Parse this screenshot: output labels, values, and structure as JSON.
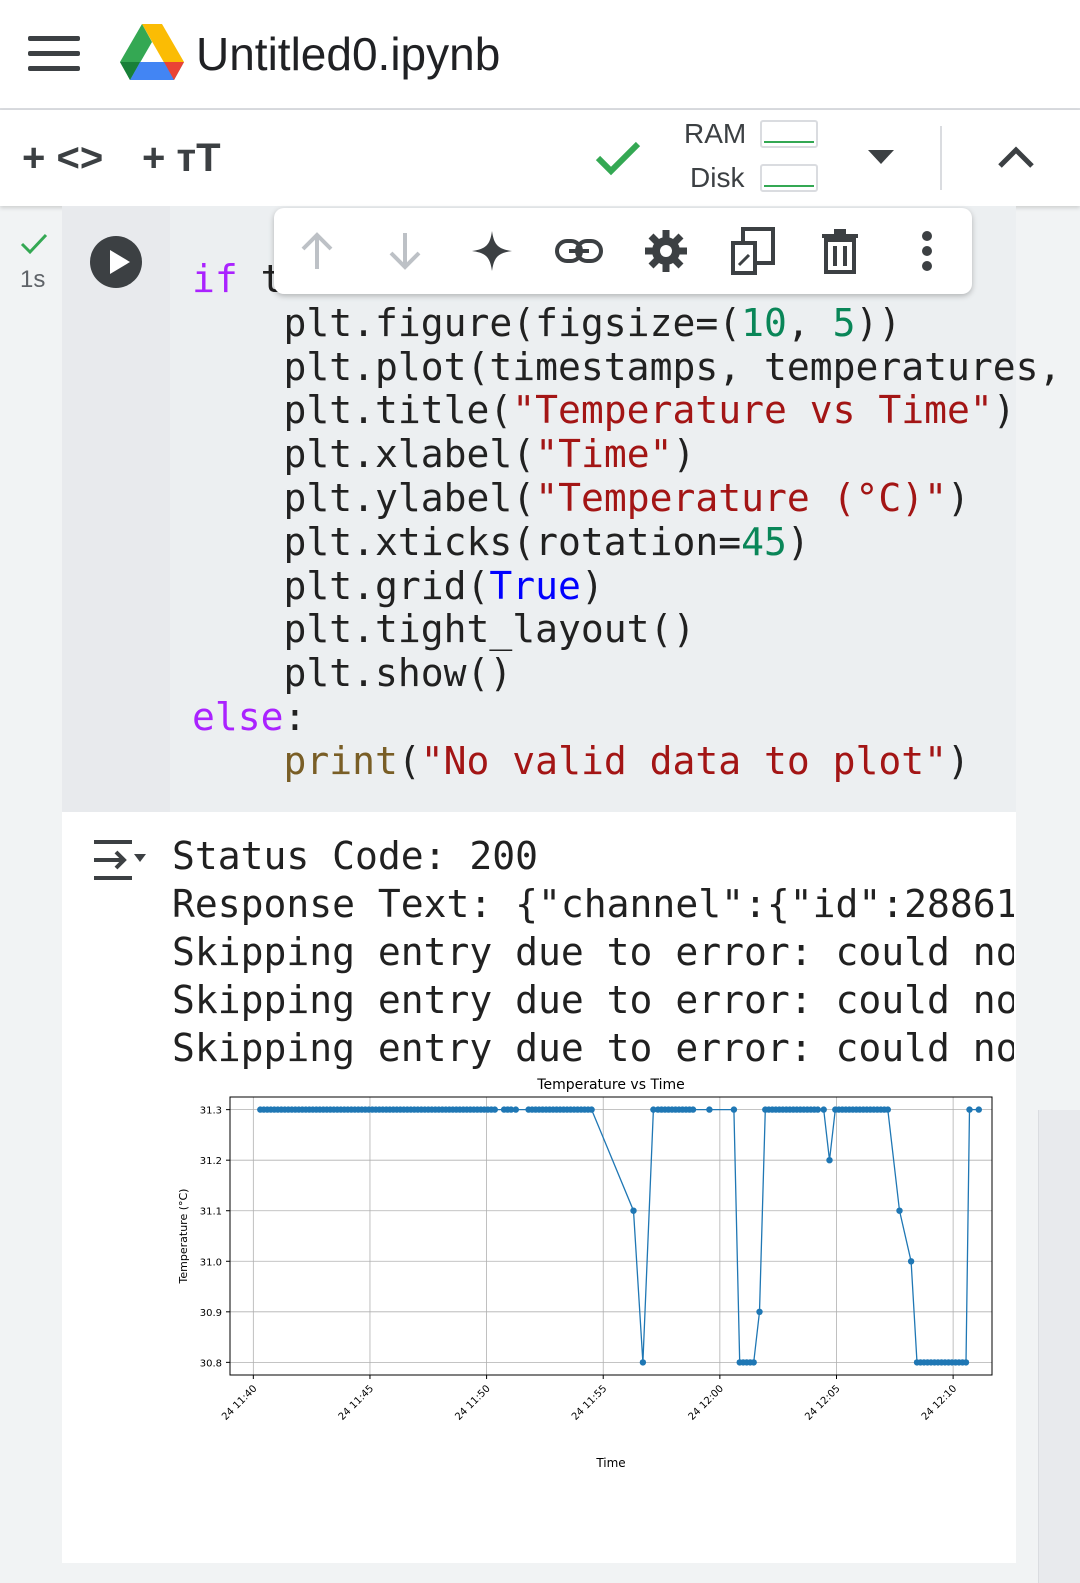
{
  "header": {
    "title": "Untitled0.ipynb"
  },
  "toolbar": {
    "add_code_label": "+ <>",
    "add_text_label": "+ тT",
    "ram_label": "RAM",
    "disk_label": "Disk"
  },
  "cell": {
    "exec_time": "1s",
    "code_lines": [
      {
        "indent": "",
        "parts": [
          {
            "t": "if",
            "c": "kw"
          },
          {
            "t": " t",
            "c": ""
          }
        ]
      },
      {
        "indent": "    ",
        "parts": [
          {
            "t": "plt.figure(figsize=(",
            "c": ""
          },
          {
            "t": "10",
            "c": "num"
          },
          {
            "t": ", ",
            "c": ""
          },
          {
            "t": "5",
            "c": "num"
          },
          {
            "t": "))",
            "c": ""
          }
        ]
      },
      {
        "indent": "    ",
        "parts": [
          {
            "t": "plt.plot(timestamps, temperatures,",
            "c": ""
          }
        ]
      },
      {
        "indent": "    ",
        "parts": [
          {
            "t": "plt.title(",
            "c": ""
          },
          {
            "t": "\"Temperature vs Time\"",
            "c": "str"
          },
          {
            "t": ")",
            "c": ""
          }
        ]
      },
      {
        "indent": "    ",
        "parts": [
          {
            "t": "plt.xlabel(",
            "c": ""
          },
          {
            "t": "\"Time\"",
            "c": "str"
          },
          {
            "t": ")",
            "c": ""
          }
        ]
      },
      {
        "indent": "    ",
        "parts": [
          {
            "t": "plt.ylabel(",
            "c": ""
          },
          {
            "t": "\"Temperature (°C)\"",
            "c": "str"
          },
          {
            "t": ")",
            "c": ""
          }
        ]
      },
      {
        "indent": "    ",
        "parts": [
          {
            "t": "plt.xticks(rotation=",
            "c": ""
          },
          {
            "t": "45",
            "c": "num"
          },
          {
            "t": ")",
            "c": ""
          }
        ]
      },
      {
        "indent": "    ",
        "parts": [
          {
            "t": "plt.grid(",
            "c": ""
          },
          {
            "t": "True",
            "c": "bool"
          },
          {
            "t": ")",
            "c": ""
          }
        ]
      },
      {
        "indent": "    ",
        "parts": [
          {
            "t": "plt.tight_layout()",
            "c": ""
          }
        ]
      },
      {
        "indent": "    ",
        "parts": [
          {
            "t": "plt.show()",
            "c": ""
          }
        ]
      },
      {
        "indent": "",
        "parts": [
          {
            "t": "else",
            "c": "kw"
          },
          {
            "t": ":",
            "c": ""
          }
        ]
      },
      {
        "indent": "    ",
        "parts": [
          {
            "t": "print",
            "c": "fn"
          },
          {
            "t": "(",
            "c": ""
          },
          {
            "t": "\"No valid data to plot\"",
            "c": "str"
          },
          {
            "t": ")",
            "c": ""
          }
        ]
      }
    ]
  },
  "output": {
    "lines": [
      "Status Code: 200",
      "Response Text: {\"channel\":{\"id\":28861",
      "Skipping entry due to error: could no",
      "Skipping entry due to error: could no",
      "Skipping entry due to error: could no"
    ]
  },
  "icons": {
    "menu": "hamburger-icon",
    "logo": "google-drive-icon",
    "saved": "check-icon",
    "dropdown": "chevron-down-icon",
    "collapse": "chevron-up-icon",
    "cell_tools": [
      "arrow-up-icon",
      "arrow-down-icon",
      "sparkle-icon",
      "link-icon",
      "gear-icon",
      "mirror-cell-icon",
      "trash-icon",
      "more-vert-icon"
    ]
  },
  "colors": {
    "series": "#1f77b4",
    "check": "#34a853",
    "keyword": "#aa22ff",
    "string": "#a31515"
  },
  "chart_data": {
    "type": "line",
    "title": "Temperature vs Time",
    "xlabel": "Time",
    "ylabel": "Temperature (°C)",
    "x_ticks": [
      "24 11:40",
      "24 11:45",
      "24 11:50",
      "24 11:55",
      "24 12:00",
      "24 12:05",
      "24 12:10"
    ],
    "y_ticks": [
      "30.8",
      "30.9",
      "31.0",
      "31.1",
      "31.2",
      "31.3"
    ],
    "ylim": [
      30.8,
      31.3
    ],
    "grid": true,
    "x_unit": "time (HH:MM:SS on the 24th)",
    "series": [
      {
        "marker": "circle",
        "points": [
          [
            "11:40:18",
            31.3
          ],
          [
            "11:40:27",
            31.3
          ],
          [
            "11:40:36",
            31.3
          ],
          [
            "11:40:45",
            31.3
          ],
          [
            "11:40:54",
            31.3
          ],
          [
            "11:41:03",
            31.3
          ],
          [
            "11:41:12",
            31.3
          ],
          [
            "11:41:21",
            31.3
          ],
          [
            "11:41:30",
            31.3
          ],
          [
            "11:41:39",
            31.3
          ],
          [
            "11:41:48",
            31.3
          ],
          [
            "11:41:57",
            31.3
          ],
          [
            "11:42:06",
            31.3
          ],
          [
            "11:42:15",
            31.3
          ],
          [
            "11:42:24",
            31.3
          ],
          [
            "11:42:33",
            31.3
          ],
          [
            "11:42:42",
            31.3
          ],
          [
            "11:42:51",
            31.3
          ],
          [
            "11:43:00",
            31.3
          ],
          [
            "11:43:09",
            31.3
          ],
          [
            "11:43:18",
            31.3
          ],
          [
            "11:43:27",
            31.3
          ],
          [
            "11:43:36",
            31.3
          ],
          [
            "11:43:45",
            31.3
          ],
          [
            "11:43:54",
            31.3
          ],
          [
            "11:44:03",
            31.3
          ],
          [
            "11:44:12",
            31.3
          ],
          [
            "11:44:21",
            31.3
          ],
          [
            "11:44:30",
            31.3
          ],
          [
            "11:44:39",
            31.3
          ],
          [
            "11:44:48",
            31.3
          ],
          [
            "11:44:57",
            31.3
          ],
          [
            "11:45:06",
            31.3
          ],
          [
            "11:45:15",
            31.3
          ],
          [
            "11:45:24",
            31.3
          ],
          [
            "11:45:33",
            31.3
          ],
          [
            "11:45:42",
            31.3
          ],
          [
            "11:45:51",
            31.3
          ],
          [
            "11:46:00",
            31.3
          ],
          [
            "11:46:09",
            31.3
          ],
          [
            "11:46:18",
            31.3
          ],
          [
            "11:46:27",
            31.3
          ],
          [
            "11:46:36",
            31.3
          ],
          [
            "11:46:45",
            31.3
          ],
          [
            "11:46:54",
            31.3
          ],
          [
            "11:47:03",
            31.3
          ],
          [
            "11:47:12",
            31.3
          ],
          [
            "11:47:21",
            31.3
          ],
          [
            "11:47:30",
            31.3
          ],
          [
            "11:47:39",
            31.3
          ],
          [
            "11:47:48",
            31.3
          ],
          [
            "11:47:57",
            31.3
          ],
          [
            "11:48:06",
            31.3
          ],
          [
            "11:48:15",
            31.3
          ],
          [
            "11:48:24",
            31.3
          ],
          [
            "11:48:33",
            31.3
          ],
          [
            "11:48:42",
            31.3
          ],
          [
            "11:48:51",
            31.3
          ],
          [
            "11:49:00",
            31.3
          ],
          [
            "11:49:09",
            31.3
          ],
          [
            "11:49:18",
            31.3
          ],
          [
            "11:49:27",
            31.3
          ],
          [
            "11:49:36",
            31.3
          ],
          [
            "11:49:45",
            31.3
          ],
          [
            "11:49:54",
            31.3
          ],
          [
            "11:50:03",
            31.3
          ],
          [
            "11:50:12",
            31.3
          ],
          [
            "11:50:21",
            31.3
          ],
          [
            "11:50:45",
            31.3
          ],
          [
            "11:50:54",
            31.3
          ],
          [
            "11:51:03",
            31.3
          ],
          [
            "11:51:15",
            31.3
          ],
          [
            "11:51:48",
            31.3
          ],
          [
            "11:51:57",
            31.3
          ],
          [
            "11:52:06",
            31.3
          ],
          [
            "11:52:15",
            31.3
          ],
          [
            "11:52:24",
            31.3
          ],
          [
            "11:52:33",
            31.3
          ],
          [
            "11:52:42",
            31.3
          ],
          [
            "11:52:51",
            31.3
          ],
          [
            "11:53:00",
            31.3
          ],
          [
            "11:53:09",
            31.3
          ],
          [
            "11:53:18",
            31.3
          ],
          [
            "11:53:27",
            31.3
          ],
          [
            "11:53:36",
            31.3
          ],
          [
            "11:53:45",
            31.3
          ],
          [
            "11:53:54",
            31.3
          ],
          [
            "11:54:03",
            31.3
          ],
          [
            "11:54:12",
            31.3
          ],
          [
            "11:54:21",
            31.3
          ],
          [
            "11:54:30",
            31.3
          ],
          [
            "11:56:18",
            31.1
          ],
          [
            "11:56:42",
            30.8
          ],
          [
            "11:57:09",
            31.3
          ],
          [
            "11:57:21",
            31.3
          ],
          [
            "11:57:30",
            31.3
          ],
          [
            "11:57:39",
            31.3
          ],
          [
            "11:57:48",
            31.3
          ],
          [
            "11:57:57",
            31.3
          ],
          [
            "11:58:06",
            31.3
          ],
          [
            "11:58:15",
            31.3
          ],
          [
            "11:58:24",
            31.3
          ],
          [
            "11:58:33",
            31.3
          ],
          [
            "11:58:42",
            31.3
          ],
          [
            "11:58:51",
            31.3
          ],
          [
            "11:59:33",
            31.3
          ],
          [
            "12:00:36",
            31.3
          ],
          [
            "12:00:51",
            30.8
          ],
          [
            "12:01:00",
            30.8
          ],
          [
            "12:01:09",
            30.8
          ],
          [
            "12:01:18",
            30.8
          ],
          [
            "12:01:27",
            30.8
          ],
          [
            "12:01:42",
            30.9
          ],
          [
            "12:01:57",
            31.3
          ],
          [
            "12:02:06",
            31.3
          ],
          [
            "12:02:15",
            31.3
          ],
          [
            "12:02:24",
            31.3
          ],
          [
            "12:02:33",
            31.3
          ],
          [
            "12:02:42",
            31.3
          ],
          [
            "12:02:51",
            31.3
          ],
          [
            "12:03:00",
            31.3
          ],
          [
            "12:03:09",
            31.3
          ],
          [
            "12:03:18",
            31.3
          ],
          [
            "12:03:27",
            31.3
          ],
          [
            "12:03:36",
            31.3
          ],
          [
            "12:03:45",
            31.3
          ],
          [
            "12:03:54",
            31.3
          ],
          [
            "12:04:03",
            31.3
          ],
          [
            "12:04:12",
            31.3
          ],
          [
            "12:04:27",
            31.3
          ],
          [
            "12:04:42",
            31.2
          ],
          [
            "12:04:57",
            31.3
          ],
          [
            "12:05:06",
            31.3
          ],
          [
            "12:05:15",
            31.3
          ],
          [
            "12:05:24",
            31.3
          ],
          [
            "12:05:33",
            31.3
          ],
          [
            "12:05:42",
            31.3
          ],
          [
            "12:05:51",
            31.3
          ],
          [
            "12:06:00",
            31.3
          ],
          [
            "12:06:09",
            31.3
          ],
          [
            "12:06:18",
            31.3
          ],
          [
            "12:06:27",
            31.3
          ],
          [
            "12:06:36",
            31.3
          ],
          [
            "12:06:45",
            31.3
          ],
          [
            "12:06:54",
            31.3
          ],
          [
            "12:07:03",
            31.3
          ],
          [
            "12:07:12",
            31.3
          ],
          [
            "12:07:42",
            31.1
          ],
          [
            "12:08:12",
            31.0
          ],
          [
            "12:08:27",
            30.8
          ],
          [
            "12:08:36",
            30.8
          ],
          [
            "12:08:45",
            30.8
          ],
          [
            "12:08:54",
            30.8
          ],
          [
            "12:09:03",
            30.8
          ],
          [
            "12:09:12",
            30.8
          ],
          [
            "12:09:21",
            30.8
          ],
          [
            "12:09:30",
            30.8
          ],
          [
            "12:09:39",
            30.8
          ],
          [
            "12:09:48",
            30.8
          ],
          [
            "12:09:57",
            30.8
          ],
          [
            "12:10:06",
            30.8
          ],
          [
            "12:10:15",
            30.8
          ],
          [
            "12:10:24",
            30.8
          ],
          [
            "12:10:33",
            30.8
          ],
          [
            "12:10:42",
            31.3
          ],
          [
            "12:11:06",
            31.3
          ]
        ]
      }
    ]
  }
}
